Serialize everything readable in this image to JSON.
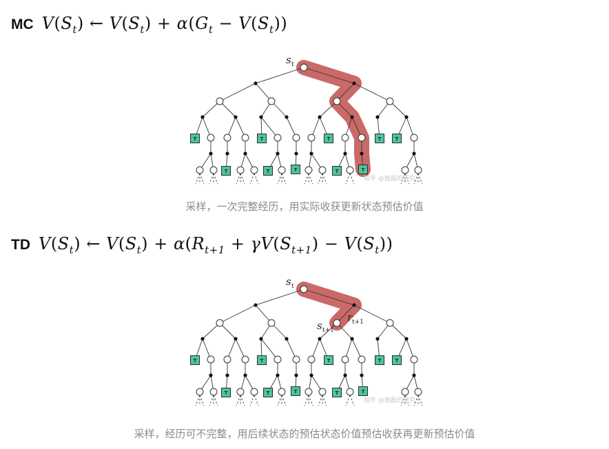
{
  "mc": {
    "tag": "MC",
    "formula": {
      "v1": "V",
      "s1": "S",
      "t1": "t",
      "arrow": "←",
      "v2": "V",
      "s2": "S",
      "t2": "t",
      "plus": "+",
      "alpha": "α",
      "g": "G",
      "tg": "t",
      "minus": "−",
      "v3": "V",
      "s3": "S",
      "t3": "t"
    },
    "root_label": "s",
    "root_sub": "t",
    "terminal_label": "T",
    "watermark": "知乎 @施磊的研究",
    "caption": "采样，一次完整经历，用实际收获更新状态预估价值"
  },
  "td": {
    "tag": "TD",
    "formula": {
      "v1": "V",
      "s1": "S",
      "t1": "t",
      "arrow": "←",
      "v2": "V",
      "s2": "S",
      "t2": "t",
      "plus1": "+",
      "alpha": "α",
      "r": "R",
      "tr": "t+1",
      "plus2": "+",
      "gamma": "γ",
      "v3": "V",
      "s3": "S",
      "t3": "t+1",
      "minus": "−",
      "v4": "V",
      "s4": "S",
      "t4": "t"
    },
    "root_label": "s",
    "root_sub": "t",
    "reward_label": "r",
    "reward_sub": "t+1",
    "next_label": "s",
    "next_sub": "t+1",
    "terminal_label": "T",
    "watermark": "知乎 @施磊的研究",
    "caption": "采样，经历可不完整，用后续状态的预估状态价值预估收获再更新预估价值"
  },
  "colors": {
    "highlight": "#c0504d",
    "terminal_fill": "#4fc3a1",
    "edge": "#333333",
    "caption": "#8a8a8a"
  }
}
